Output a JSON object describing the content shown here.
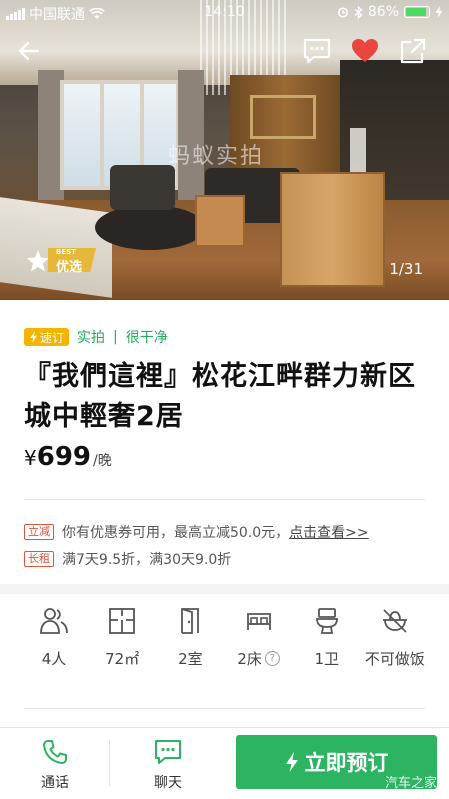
{
  "status_bar": {
    "carrier": "中国联通",
    "time": "14:10",
    "battery": "86%"
  },
  "hero": {
    "watermark": "蚂蚁实拍",
    "best_badge_top": "BEST",
    "best_badge_label": "优选",
    "photo_count": "1/31"
  },
  "tags": {
    "express": "速订",
    "verified": "实拍",
    "separator": "|",
    "clean": "很干净"
  },
  "listing": {
    "title": "『我們這裡』松花江畔群力新区城中輕奢2居",
    "price_currency": "¥",
    "price_amount": "699",
    "price_unit": "/晚"
  },
  "promos": [
    {
      "tag": "立减",
      "text": "你有优惠券可用，最高立减50.0元，",
      "link": "点击查看>>"
    },
    {
      "tag": "长租",
      "text": "满7天9.5折，满30天9.0折",
      "link": ""
    }
  ],
  "amenities": [
    {
      "icon": "guests-icon",
      "label": "4人"
    },
    {
      "icon": "floorplan-icon",
      "label": "72㎡"
    },
    {
      "icon": "door-icon",
      "label": "2室"
    },
    {
      "icon": "bed-icon",
      "label": "2床"
    },
    {
      "icon": "toilet-icon",
      "label": "1卫"
    },
    {
      "icon": "no-cooking-icon",
      "label": "不可做饭"
    }
  ],
  "bottom_bar": {
    "call_label": "通话",
    "chat_label": "聊天",
    "book_label": "立即预订",
    "brand_watermark": "汽车之家"
  },
  "colors": {
    "accent_green": "#2db463",
    "favorite_red": "#e8463f",
    "express_yellow": "#f6b400",
    "promo_red": "#e2533b"
  }
}
